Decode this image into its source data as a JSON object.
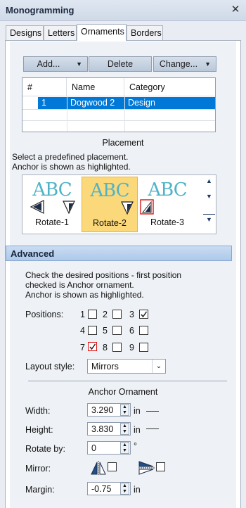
{
  "window": {
    "title": "Monogramming",
    "close_glyph": "✕"
  },
  "tabs": [
    {
      "label": "Designs",
      "active": false
    },
    {
      "label": "Letters",
      "active": false
    },
    {
      "label": "Ornaments",
      "active": true
    },
    {
      "label": "Borders",
      "active": false
    }
  ],
  "toolbar": {
    "add_label": "Add...",
    "delete_label": "Delete",
    "change_label": "Change..."
  },
  "table": {
    "headers": [
      "#",
      "Name",
      "Category"
    ],
    "rows": [
      {
        "num": "1",
        "name": "Dogwood 2",
        "category": "Design",
        "selected": true
      }
    ]
  },
  "placement": {
    "heading": "Placement",
    "instructions_line1": "Select a predefined placement.",
    "instructions_line2": "Anchor is shown as highlighted.",
    "items": [
      {
        "label": "Rotate-1",
        "preview_text": "ABC",
        "selected": false
      },
      {
        "label": "Rotate-2",
        "preview_text": "ABC",
        "selected": true
      },
      {
        "label": "Rotate-3",
        "preview_text": "ABC",
        "selected": false
      }
    ]
  },
  "advanced": {
    "header": "Advanced",
    "instructions_line1": "Check the desired positions - first position",
    "instructions_line2": "checked is Anchor ornament.",
    "instructions_line3": "Anchor is shown as highlighted.",
    "positions_label": "Positions:",
    "positions": [
      {
        "num": "1",
        "checked": false
      },
      {
        "num": "2",
        "checked": false
      },
      {
        "num": "3",
        "checked": true
      },
      {
        "num": "4",
        "checked": false
      },
      {
        "num": "5",
        "checked": false
      },
      {
        "num": "6",
        "checked": false
      },
      {
        "num": "7",
        "checked": true,
        "anchor": true
      },
      {
        "num": "8",
        "checked": false
      },
      {
        "num": "9",
        "checked": false
      }
    ],
    "layout_style_label": "Layout style:",
    "layout_style_value": "Mirrors"
  },
  "anchor": {
    "heading": "Anchor Ornament",
    "width_label": "Width:",
    "width_value": "3.290",
    "width_unit": "in",
    "height_label": "Height:",
    "height_value": "3.830",
    "height_unit": "in",
    "rotate_label": "Rotate by:",
    "rotate_value": "0",
    "rotate_unit": "°",
    "mirror_label": "Mirror:",
    "margin_label": "Margin:",
    "margin_value": "-0.75",
    "margin_unit": "in"
  },
  "colors": {
    "accent": "#0078d7",
    "selection_highlight": "#fbd97a",
    "preview_text": "#4fb3c8"
  }
}
